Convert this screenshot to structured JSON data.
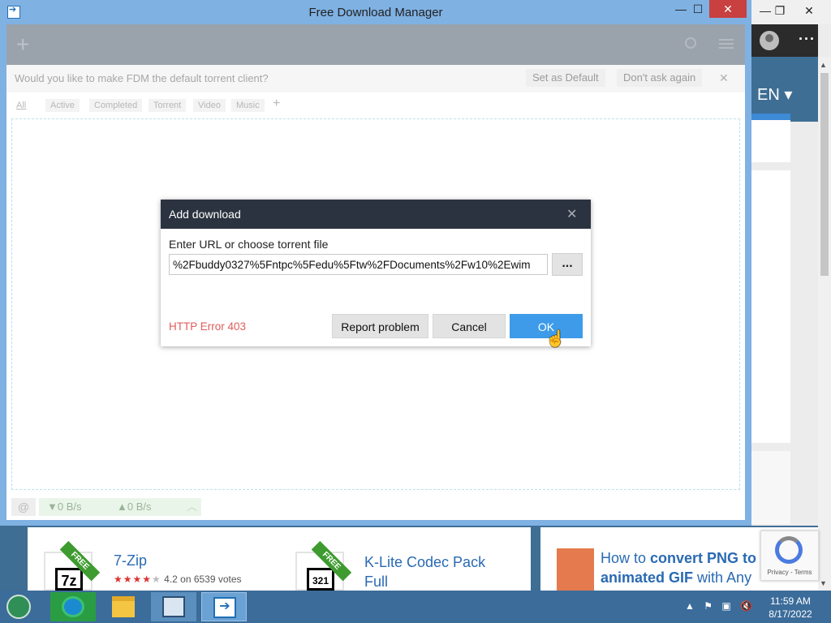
{
  "background_browser": {
    "language": "EN",
    "programs": [
      {
        "name": "7-Zip",
        "badge": "FREE",
        "icon_text": "7z",
        "rating_text": "4.2 on 6539 votes"
      },
      {
        "name_line1": "K-Lite Codec Pack",
        "name_line2": "Full",
        "badge": "FREE",
        "icon_text": "321"
      }
    ],
    "promo": {
      "part1": "How to ",
      "bold1": "convert PNG to",
      "bold2": "animated GIF",
      "part2": " with Any"
    },
    "recaptcha_terms": "Privacy - Terms"
  },
  "fdm": {
    "window_title": "Free Download Manager",
    "notice": {
      "text": "Would you like to make FDM the default torrent client?",
      "set_default": "Set as Default",
      "dont_ask": "Don't ask again"
    },
    "tabs": [
      "All",
      "Active",
      "Completed",
      "Torrent",
      "Video",
      "Music"
    ],
    "status": {
      "download_speed": "▼0 B/s",
      "upload_speed": "▲0 B/s"
    }
  },
  "dialog": {
    "title": "Add download",
    "label": "Enter URL or choose torrent file",
    "url_value": "%2Fbuddy0327%5Fntpc%5Fedu%5Ftw%2FDocuments%2Fw10%2Ewim",
    "browse_label": "...",
    "error": "HTTP Error 403",
    "report_button": "Report problem",
    "cancel_button": "Cancel",
    "ok_button": "OK"
  },
  "taskbar": {
    "time": "11:59 AM",
    "date": "8/17/2022"
  }
}
